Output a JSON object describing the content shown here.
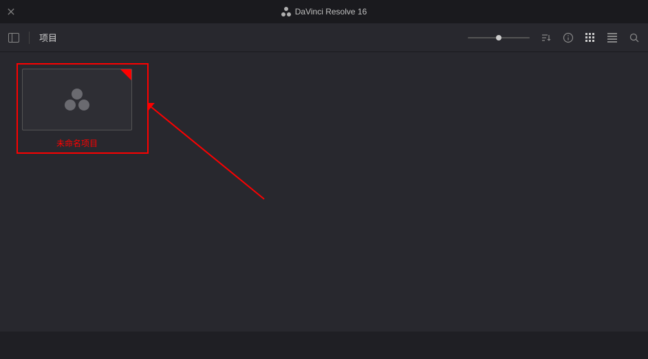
{
  "titlebar": {
    "app_title": "DaVinci Resolve 16"
  },
  "toolbar": {
    "breadcrumb": "项目",
    "zoom_percent": 50
  },
  "projects": [
    {
      "label": "未命名项目"
    }
  ],
  "annotation": {
    "highlight_color": "#ff0000"
  }
}
